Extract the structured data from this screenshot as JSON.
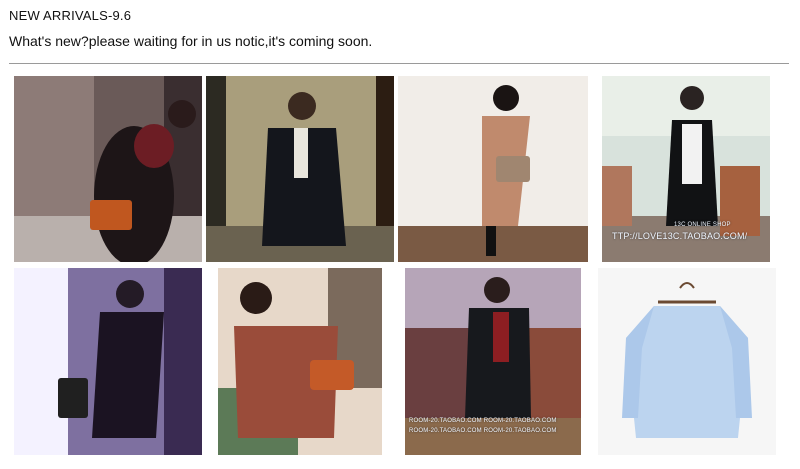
{
  "header": {
    "title": "NEW ARRIVALS-9.6",
    "subtitle": "What's new?please waiting for in us notic,it's coming soon."
  },
  "gallery": {
    "watermarks": {
      "shop": "TTP://LOVE13C.TAOBAO.COM/",
      "shop_top": "13C ONLINE SHOP",
      "room": "ROOM-20.TAOBAO.COM ROOM-20.TAOBAO.COM",
      "room2": "ROOM-20.TAOBAO.COM ROOM-20.TAOBAO.COM"
    }
  }
}
